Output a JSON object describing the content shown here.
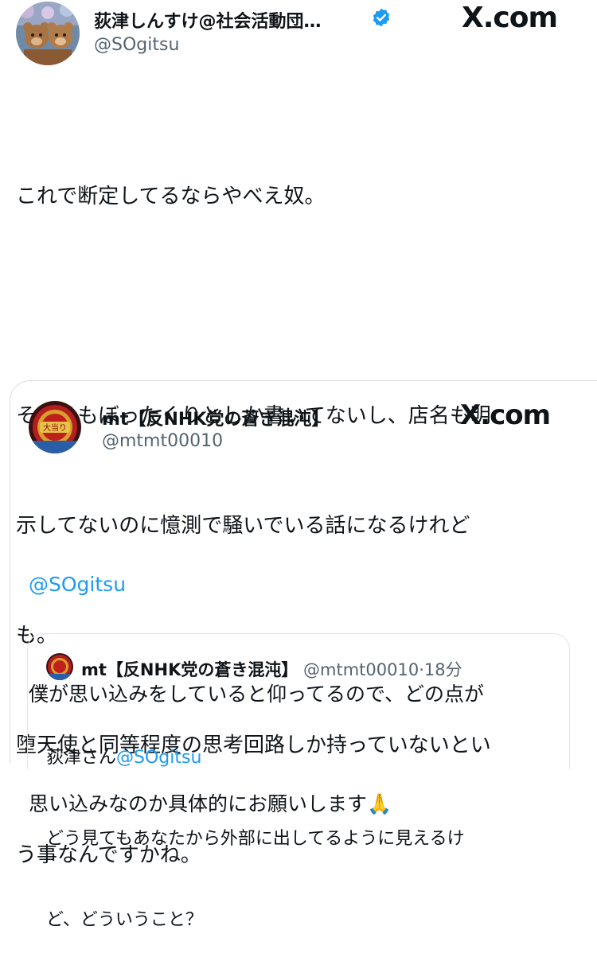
{
  "colors": {
    "text": "#0f1419",
    "secondary": "#536471",
    "accent": "#1d9bf0",
    "border": "#d9dee3"
  },
  "main_post": {
    "display_name": "荻津しんすけ@社会活動団…",
    "handle": "@SOgitsu",
    "verified_icon": "verified-badge-icon",
    "brand": "X.com",
    "body_lines": [
      "これで断定してるならやべえ奴。",
      "",
      "そもそもぼったくりとしか書いてないし、店名も明",
      "示してないのに憶測で騒いでいる話になるけれど",
      "も。",
      "堕天使と同等程度の思考回路しか持っていないとい",
      "う事なんですかね。"
    ]
  },
  "quoted_post": {
    "display_name": "mt【反NHK党の蒼き混沌】",
    "handle": "@mtmt00010",
    "brand": "X.com",
    "mention": "@SOgitsu",
    "body_lines": [
      "僕が思い込みをしていると仰ってるので、どの点が",
      "思い込みなのか具体的にお願いします🙏"
    ]
  },
  "nested_quote": {
    "display_name": "mt【反NHK党の蒼き混沌】",
    "handle": "@mtmt00010",
    "separator": "·",
    "time": "18分",
    "line1_prefix": "荻津さん",
    "line1_mention": "@SOgitsu",
    "line2": "どう見てもあなたから外部に出してるように見えるけ",
    "line3": "ど、どういうこと？"
  }
}
